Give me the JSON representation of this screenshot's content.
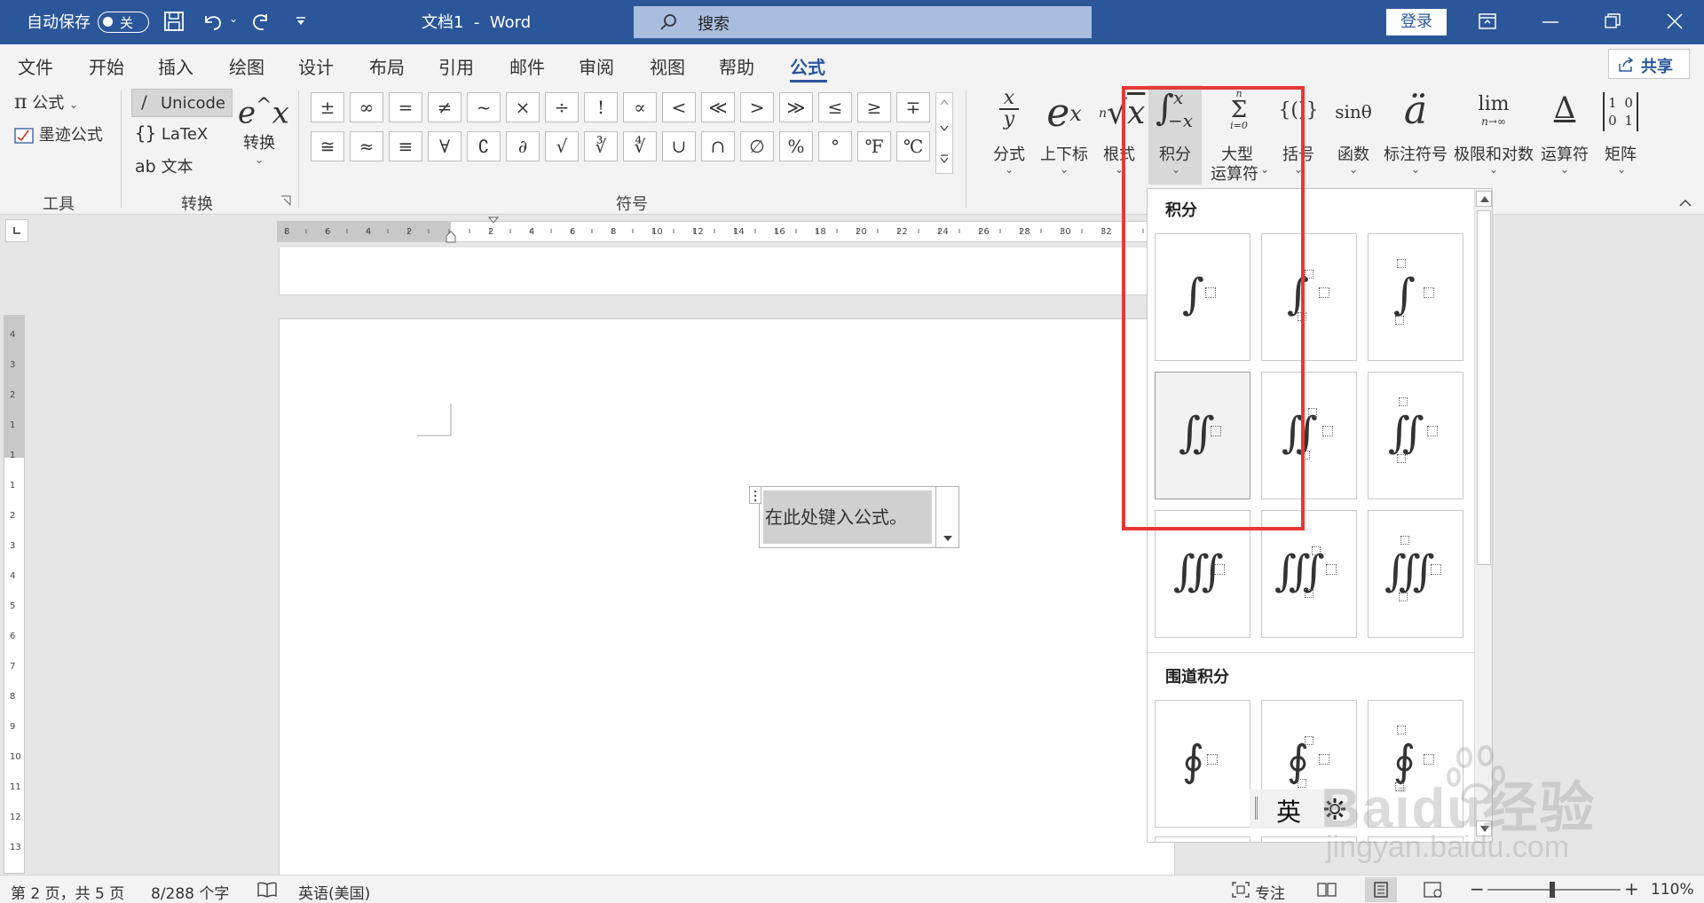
{
  "titlebar": {
    "autosave_label": "自动保存",
    "autosave_toggle": "关",
    "doc_title": "文档1",
    "separator": "-",
    "app_name": "Word",
    "search_placeholder": "搜索",
    "login_label": "登录"
  },
  "menu": {
    "items": [
      "文件",
      "开始",
      "插入",
      "绘图",
      "设计",
      "布局",
      "引用",
      "邮件",
      "审阅",
      "视图",
      "帮助",
      "公式"
    ],
    "share_label": "共享"
  },
  "ribbon": {
    "tools": {
      "formula_label": "公式",
      "ink_label": "墨迹公式",
      "group_label": "工具"
    },
    "convert": {
      "unicode_label": "Unicode",
      "latex_label": "LaTeX",
      "text_label": "文本",
      "convert_label": "转换",
      "group_label": "转换"
    },
    "symbols": {
      "row1": [
        "±",
        "∞",
        "=",
        "≠",
        "~",
        "×",
        "÷",
        "!",
        "∝",
        "<",
        "≪",
        ">",
        "≫",
        "≤",
        "≥",
        "∓"
      ],
      "row2": [
        "≅",
        "≈",
        "≡",
        "∀",
        "∁",
        "∂",
        "√",
        "∛",
        "∜",
        "∪",
        "∩",
        "∅",
        "%",
        "°",
        "℉",
        "℃"
      ],
      "group_label": "符号"
    },
    "structures": [
      {
        "label": "分式",
        "icon": "fraction-icon"
      },
      {
        "label": "上下标",
        "icon": "script-icon"
      },
      {
        "label": "根式",
        "icon": "radical-icon"
      },
      {
        "label": "积分",
        "icon": "integral-icon"
      },
      {
        "label": "大型",
        "label2": "运算符",
        "icon": "large-operator-icon"
      },
      {
        "label": "括号",
        "icon": "bracket-icon"
      },
      {
        "label": "函数",
        "icon": "function-icon"
      },
      {
        "label": "标注符号",
        "icon": "accent-icon"
      },
      {
        "label": "极限和对数",
        "icon": "limit-icon"
      },
      {
        "label": "运算符",
        "icon": "operator-icon"
      },
      {
        "label": "矩阵",
        "icon": "matrix-icon"
      }
    ],
    "structure_icon_text": {
      "fraction_num": "x",
      "fraction_den": "y",
      "script_base": "e",
      "script_sup": "x",
      "radical_index": "n",
      "radical_body": "x",
      "integral_upper": "x",
      "integral_lower": "−x",
      "sum_upper": "n",
      "sum_lower": "i=0",
      "bracket": "{()}",
      "function": "sinθ",
      "accent": "ä",
      "limit_top": "lim",
      "limit_bottom": "n→∞",
      "operator": "Δ",
      "matrix": "1 0 0 1"
    }
  },
  "document": {
    "placeholder": "在此处键入公式。"
  },
  "dropdown": {
    "section1_title": "积分",
    "section2_title": "围道积分"
  },
  "ime": {
    "mode": "英"
  },
  "ruler": {
    "ticks": [
      "8",
      "6",
      "4",
      "2",
      "2",
      "4",
      "6",
      "8",
      "10",
      "12",
      "14",
      "16",
      "18",
      "20",
      "22",
      "24",
      "26",
      "28",
      "30",
      "32"
    ],
    "vticks": [
      "4",
      "3",
      "2",
      "1",
      "1",
      "1",
      "2",
      "3",
      "4",
      "5",
      "6",
      "7",
      "8",
      "9",
      "10",
      "11",
      "12",
      "13"
    ]
  },
  "statusbar": {
    "page": "第 2 页，共 5 页",
    "words": "8/288 个字",
    "language": "英语(美国)",
    "focus": "专注",
    "zoom": "110%"
  },
  "watermark": {
    "text": "Baidu经验",
    "url": "jingyan.baidu.com"
  },
  "colors": {
    "accent": "#2b579a",
    "highlight_box": "#e53935"
  }
}
